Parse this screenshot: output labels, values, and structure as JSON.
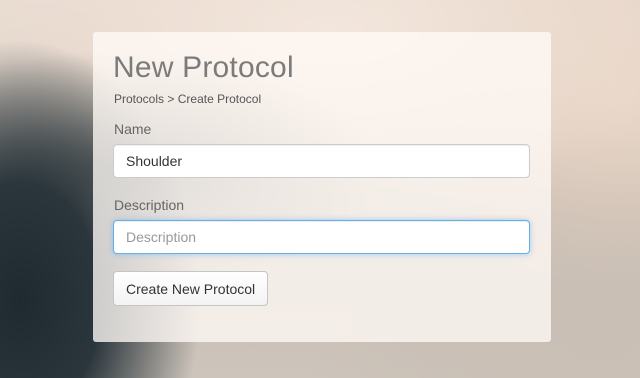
{
  "header": {
    "title": "New Protocol",
    "breadcrumb": {
      "parent": "Protocols",
      "separator": ">",
      "current": "Create Protocol"
    }
  },
  "form": {
    "name": {
      "label": "Name",
      "value": "Shoulder"
    },
    "description": {
      "label": "Description",
      "value": "",
      "placeholder": "Description",
      "focused": true
    },
    "submit_label": "Create New Protocol"
  },
  "colors": {
    "focus_border": "#66afe9",
    "title_text": "#7b7b7b",
    "card_background": "#fffaf6"
  }
}
